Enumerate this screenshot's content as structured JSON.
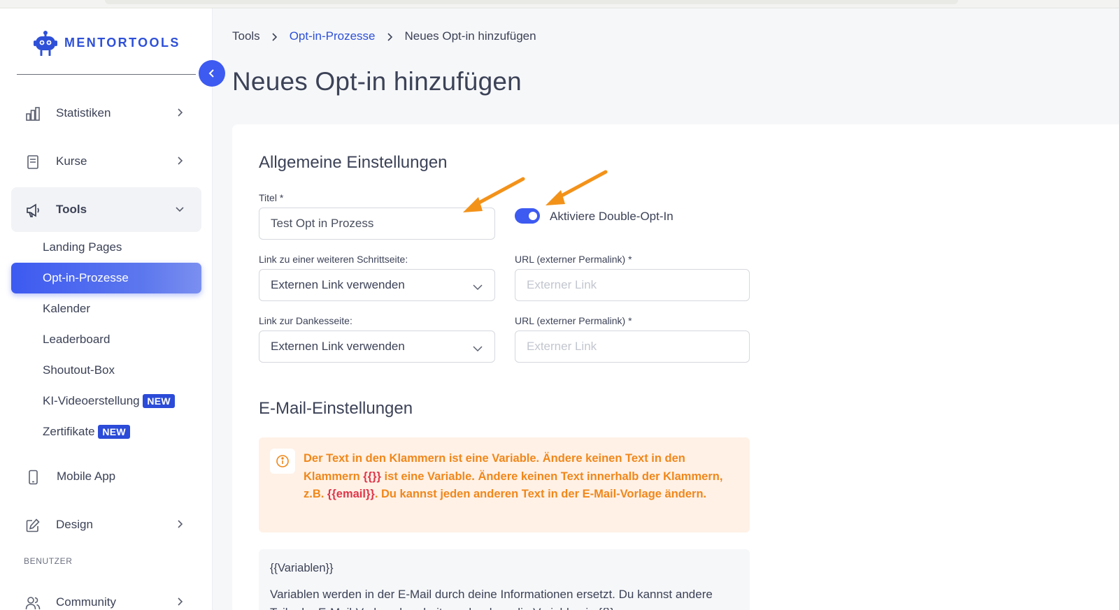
{
  "brand": {
    "name": "MENTORTOOLS",
    "accent": "#3d5af1",
    "link_color": "#2e50d8",
    "warning_color": "#f0871a"
  },
  "sidebar": {
    "items": [
      {
        "label": "Statistiken",
        "icon": "bar-chart-icon"
      },
      {
        "label": "Kurse",
        "icon": "book-icon"
      },
      {
        "label": "Tools",
        "icon": "megaphone-icon"
      },
      {
        "label": "Mobile App",
        "icon": "smartphone-icon"
      },
      {
        "label": "Design",
        "icon": "pencil-icon"
      }
    ],
    "tools_sub": [
      {
        "label": "Landing Pages"
      },
      {
        "label": "Opt-in-Prozesse"
      },
      {
        "label": "Kalender"
      },
      {
        "label": "Leaderboard"
      },
      {
        "label": "Shoutout-Box"
      },
      {
        "label": "KI-Videoerstellung",
        "badge": "NEW"
      },
      {
        "label": "Zertifikate",
        "badge": "NEW"
      }
    ],
    "section_label": "BENUTZER",
    "community": {
      "label": "Community",
      "icon": "users-icon"
    }
  },
  "breadcrumb": {
    "root": "Tools",
    "parent": "Opt-in-Prozesse",
    "current": "Neues Opt-in hinzufügen"
  },
  "page_title": "Neues Opt-in hinzufügen",
  "general": {
    "section_title": "Allgemeine Einstellungen",
    "title_label": "Titel *",
    "title_value": "Test Opt in Prozess",
    "double_optin_label": "Aktiviere Double-Opt-In",
    "double_optin_enabled": true,
    "step_link_label": "Link zu einer weiteren Schrittseite:",
    "step_link_value": "Externen Link verwenden",
    "url1_label": "URL (externer Permalink) *",
    "url1_placeholder": "Externer Link",
    "thanks_link_label": "Link zur Dankesseite:",
    "thanks_link_value": "Externen Link verwenden",
    "url2_label": "URL (externer Permalink) *",
    "url2_placeholder": "Externer Link"
  },
  "email": {
    "section_title": "E-Mail-Einstellungen",
    "info_part1": "Der Text in den Klammern ist eine Variable. Ändere keinen Text in den Klammern ",
    "info_var1": "{{}}",
    "info_part2": " ist eine Variable. Ändere keinen Text innerhalb der Klammern, z.B. ",
    "info_var2": "{{email}}",
    "info_part3": ". Du kannst jeden anderen Text in der E-Mail-Vorlage ändern.",
    "variables_title": "{{Variablen}}",
    "variables_desc": "Variablen werden in der E-Mail durch deine Informationen ersetzt. Du kannst andere Teile der E-Mail-Vorlage bearbeiten, aber lass die Variablen in {{}}"
  }
}
